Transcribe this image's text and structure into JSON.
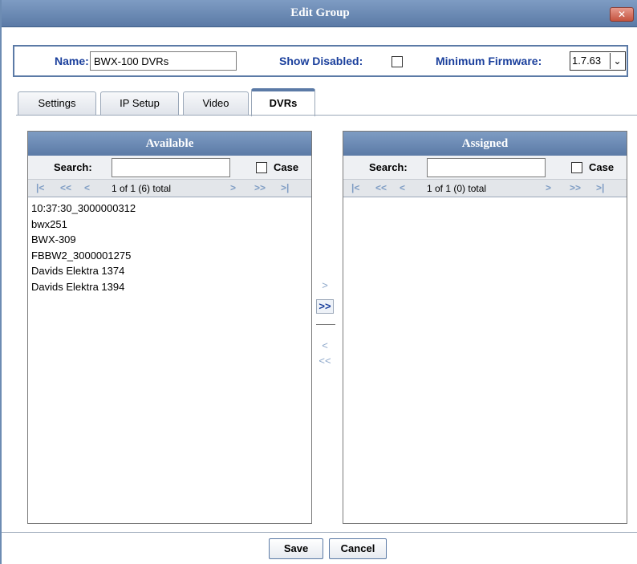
{
  "dialog": {
    "title": "Edit Group",
    "close_label": "✕"
  },
  "filters": {
    "name_label": "Name:",
    "name_value": "BWX-100 DVRs",
    "show_disabled_label": "Show Disabled:",
    "show_disabled_checked": false,
    "min_firmware_label": "Minimum Firmware:",
    "min_firmware_value": "1.7.63"
  },
  "tabs": [
    {
      "label": "Settings",
      "active": false
    },
    {
      "label": "IP Setup",
      "active": false
    },
    {
      "label": "Video",
      "active": false
    },
    {
      "label": "DVRs",
      "active": true
    }
  ],
  "available": {
    "header": "Available",
    "search_label": "Search:",
    "search_value": "",
    "case_label": "Case",
    "pager_info": "1 of 1 (6) total",
    "items": [
      "10:37:30_3000000312",
      "bwx251",
      "BWX-309",
      "FBBW2_3000001275",
      "Davids Elektra 1374",
      "Davids Elektra 1394"
    ]
  },
  "assigned": {
    "header": "Assigned",
    "search_label": "Search:",
    "search_value": "",
    "case_label": "Case",
    "pager_info": "1 of 1 (0) total",
    "items": []
  },
  "pager_icons": {
    "first": "|<",
    "prev_page": "<<",
    "prev": "<",
    "next": ">",
    "next_page": ">>",
    "last": ">|"
  },
  "move_buttons": {
    "add_one": ">",
    "add_all": ">>",
    "remove_one": "<",
    "remove_all": "<<"
  },
  "footer": {
    "save_label": "Save",
    "cancel_label": "Cancel"
  }
}
